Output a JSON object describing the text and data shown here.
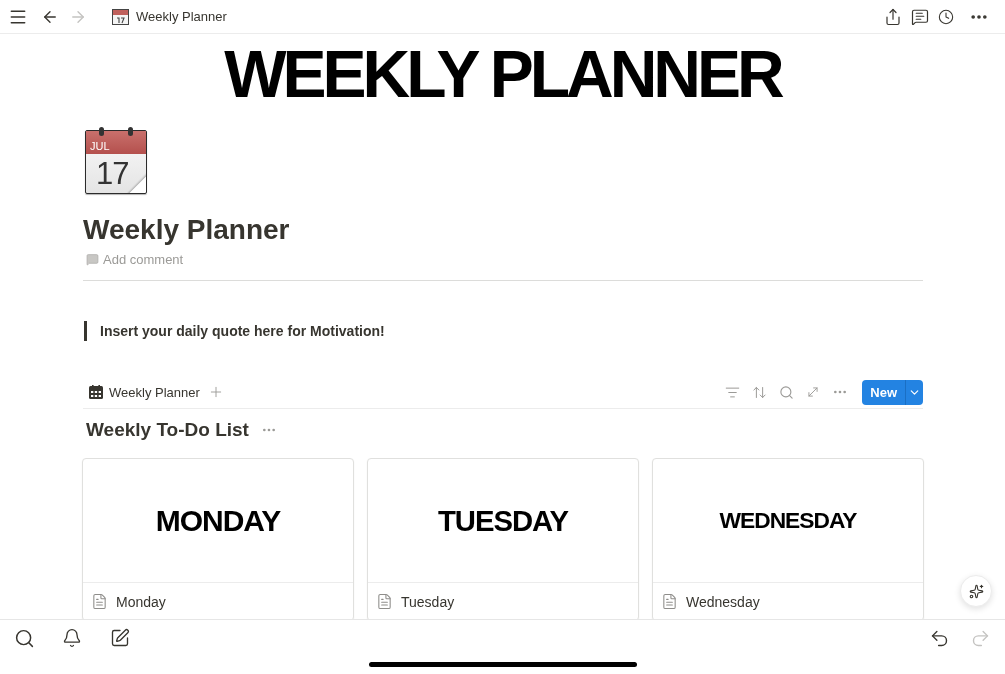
{
  "top_bar": {
    "title": "Weekly Planner",
    "back": {
      "disabled": false
    },
    "forward": {
      "disabled": true
    }
  },
  "cover": {
    "title": "WEEKLY PLANNER"
  },
  "page": {
    "icon": {
      "month": "JUL",
      "day": "17"
    },
    "title": "Weekly Planner",
    "comment_prompt": "Add comment",
    "quote": "Insert your daily quote here for Motivation!"
  },
  "database": {
    "views": [
      {
        "label": "Weekly Planner"
      }
    ],
    "new_button": "New",
    "title": "Weekly To-Do List",
    "cards": [
      {
        "cover_text": "MONDAY",
        "name": "Monday"
      },
      {
        "cover_text": "TUESDAY",
        "name": "Tuesday"
      },
      {
        "cover_text": "WEDNESDAY",
        "name": "Wednesday"
      }
    ]
  },
  "bottom_bar": {
    "undo": {
      "disabled": false
    },
    "redo": {
      "disabled": true
    }
  }
}
